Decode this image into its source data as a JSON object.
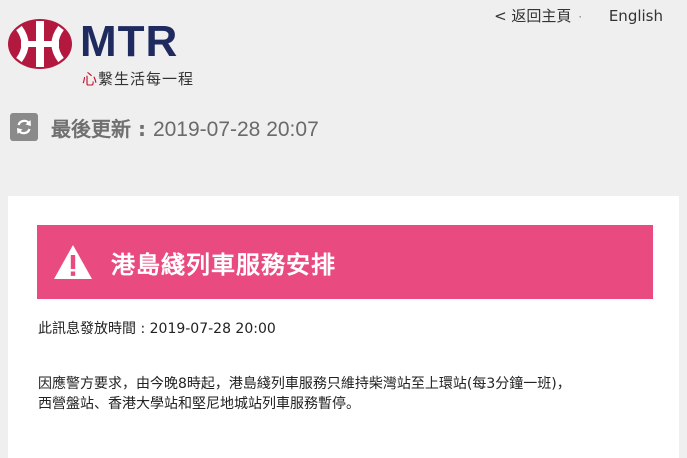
{
  "header": {
    "brand_name": "MTR",
    "tagline_accent": "心",
    "tagline_rest": "繫生活每一程",
    "back_link": "< 返回主頁",
    "separator": "·",
    "language_link": "English"
  },
  "status": {
    "last_updated_label": "最後更新 : ",
    "last_updated_value": "2019-07-28 20:07",
    "refresh_icon": "refresh-icon"
  },
  "notice": {
    "title": "港島綫列車服務安排",
    "warning_icon": "warning-icon",
    "issue_time_label": "此訊息發放時間 : ",
    "issue_time_value": "2019-07-28 20:00",
    "message_line_1": "因應警方要求，由今晚8時起，港島綫列車服務只維持柴灣站至上環站(每3分鐘一班)，",
    "message_line_2": "西營盤站、香港大學站和堅尼地城站列車服務暫停。"
  },
  "colors": {
    "brand_red": "#b3193f",
    "brand_navy": "#1f2a5e",
    "alert_pink": "#e94b81",
    "background": "#efefef"
  }
}
